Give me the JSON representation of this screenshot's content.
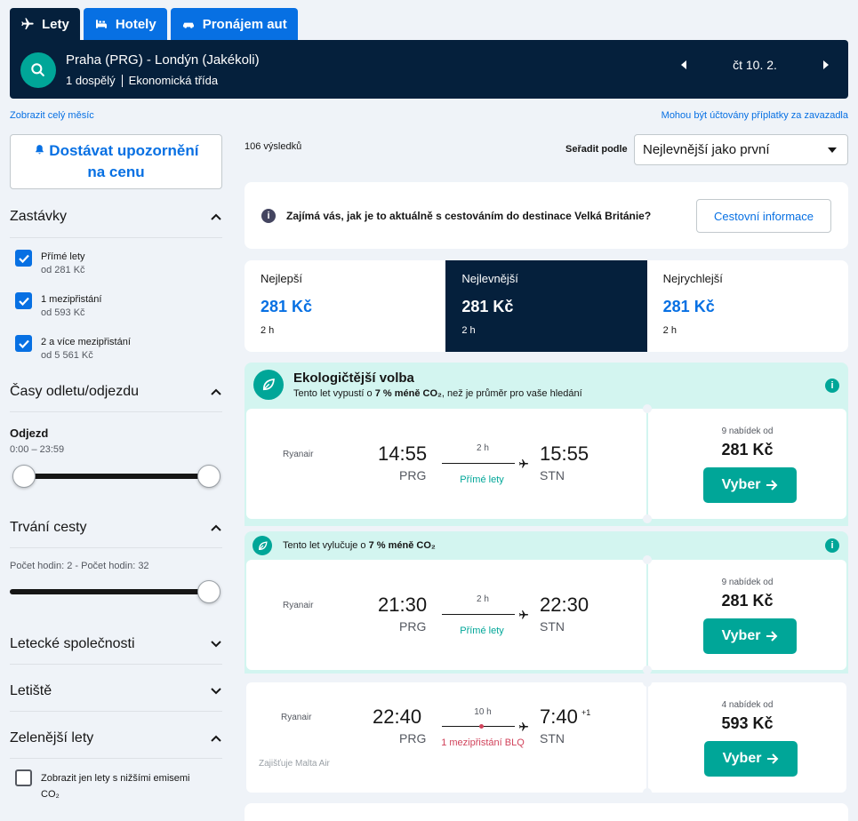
{
  "tabs": [
    {
      "label": "Lety",
      "icon": "plane-icon"
    },
    {
      "label": "Hotely",
      "icon": "bed-icon"
    },
    {
      "label": "Pronájem aut",
      "icon": "car-icon"
    }
  ],
  "header": {
    "route": "Praha (PRG) - Londýn (Jakékoli)",
    "passengers": "1 dospělý",
    "cabin": "Ekonomická třída",
    "date": "čt 10. 2."
  },
  "links": {
    "month": "Zobrazit celý měsíc",
    "fees": "Mohou být účtovány příplatky za zavazadla"
  },
  "alert_button": "Dostávat upozornění na cenu",
  "filters": {
    "stops": {
      "title": "Zastávky",
      "options": [
        {
          "label": "Přímé lety",
          "sub": "od 281 Kč"
        },
        {
          "label": "1 mezipřistání",
          "sub": "od 593 Kč"
        },
        {
          "label": "2 a více mezipřistání",
          "sub": "od 5 561 Kč"
        }
      ]
    },
    "times": {
      "title": "Časy odletu/odjezdu",
      "label": "Odjezd",
      "range": "0:00 – 23:59"
    },
    "duration": {
      "title": "Trvání cesty",
      "range": "Počet hodin: 2 - Počet hodin: 32"
    },
    "airlines": {
      "title": "Letecké společnosti"
    },
    "airports": {
      "title": "Letiště"
    },
    "greener": {
      "title": "Zelenější lety",
      "option": "Zobrazit jen lety s nižšími emisemi",
      "option_line2": "CO₂"
    }
  },
  "results": {
    "count": "106 výsledků",
    "sort_label": "Seřadit podle",
    "sort_value": "Nejlevnější jako první"
  },
  "info": {
    "text": "Zajímá vás, jak je to aktuálně s cestováním do destinace Velká Británie?",
    "button": "Cestovní informace"
  },
  "sort_tabs": [
    {
      "name": "Nejlepší",
      "price": "281 Kč",
      "duration": "2 h"
    },
    {
      "name": "Nejlevnější",
      "price": "281 Kč",
      "duration": "2 h"
    },
    {
      "name": "Nejrychlejší",
      "price": "281 Kč",
      "duration": "2 h"
    }
  ],
  "eco1": {
    "title": "Ekologičtější volba",
    "text_pre": "Tento let vypustí o ",
    "text_bold": "7 % méně CO₂",
    "text_post": ", než je průměr pro vaše hledání"
  },
  "eco2": {
    "text_pre": "Tento let vylučuje o ",
    "text_bold": "7 % méně CO₂"
  },
  "flights": [
    {
      "airline": "Ryanair",
      "dep_time": "14:55",
      "dep": "PRG",
      "duration": "2 h",
      "stops": "Přímé lety",
      "arr_time": "15:55",
      "arr": "STN",
      "offers": "9 nabídek od",
      "price": "281 Kč",
      "cta": "Vyber"
    },
    {
      "airline": "Ryanair",
      "dep_time": "21:30",
      "dep": "PRG",
      "duration": "2 h",
      "stops": "Přímé lety",
      "arr_time": "22:30",
      "arr": "STN",
      "offers": "9 nabídek od",
      "price": "281 Kč",
      "cta": "Vyber"
    },
    {
      "airline": "Ryanair",
      "dep_time": "22:40",
      "dep": "PRG",
      "duration": "10 h",
      "stops": "1 mezipřistání BLQ",
      "arr_time": "7:40",
      "arr_plus": "+1",
      "arr": "STN",
      "offers": "4 nabídek od",
      "price": "593 Kč",
      "cta": "Vyber",
      "operated": "Zajišťuje Malta Air"
    }
  ],
  "colors": {
    "navy": "#05203c",
    "blue": "#0770e3",
    "teal": "#00a698",
    "eco_bg": "#d3f5f0",
    "stop_red": "#d1435b"
  }
}
